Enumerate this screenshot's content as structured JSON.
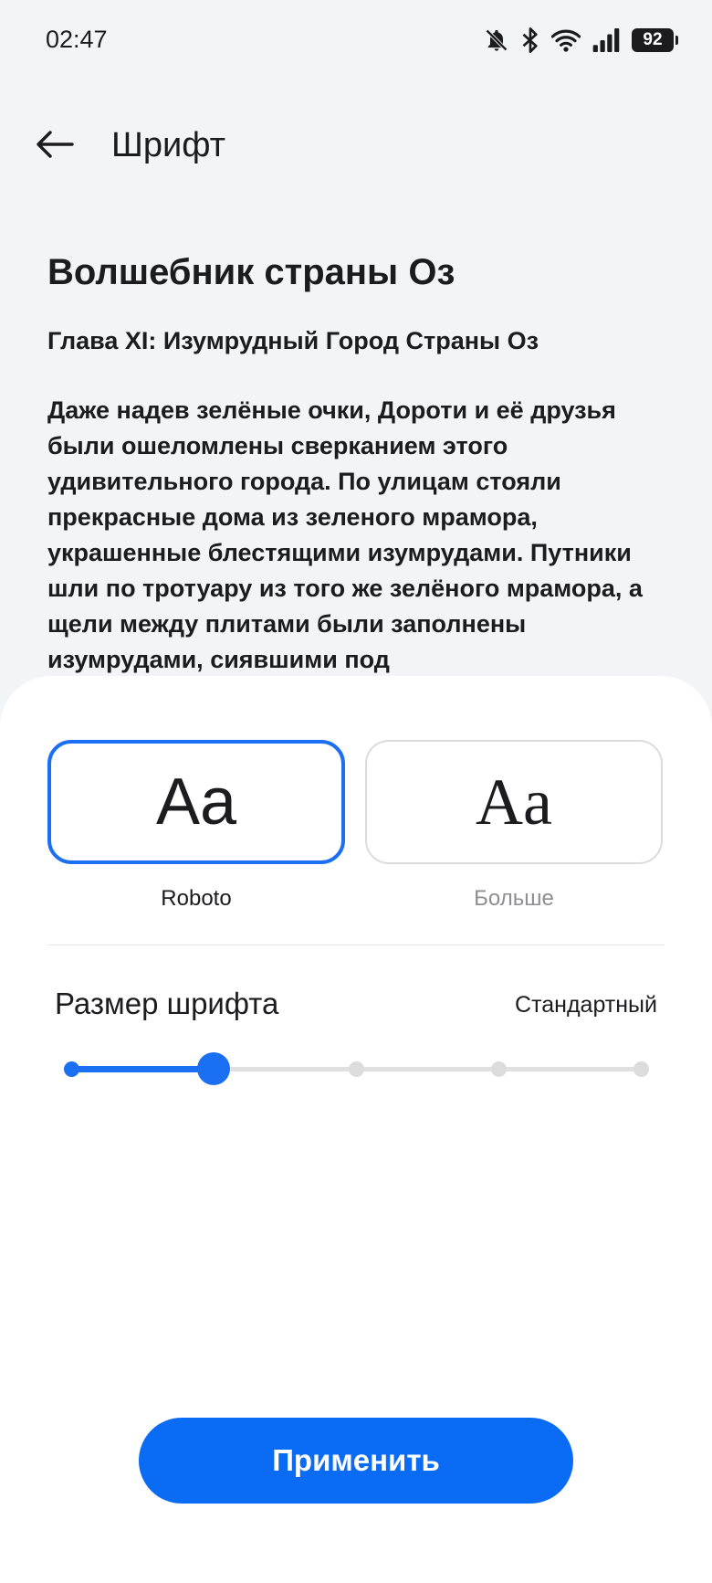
{
  "status_bar": {
    "time": "02:47",
    "battery": "92",
    "icons": [
      "bell-off-icon",
      "bluetooth-icon",
      "wifi-icon",
      "signal-icon",
      "battery-icon"
    ]
  },
  "header": {
    "title": "Шрифт",
    "back_icon": "arrow-left-icon"
  },
  "preview": {
    "title": "Волшебник страны Оз",
    "chapter": "Глава XI: Изумрудный Город Страны Оз",
    "body": "Даже надев зелёные очки, Дороти и её друзья были ошеломлены сверканием этого удивительного города. По улицам стояли прекрасные дома из зеленого мрамора, украшенные блестящими изумрудами. Путники шли по тротуару из того же зелёного мрамора, а щели между плитами были заполнены изумрудами, сиявшими под"
  },
  "font_options": [
    {
      "sample": "Aa",
      "label": "Roboto",
      "selected": true
    },
    {
      "sample": "Aa",
      "label": "Больше",
      "selected": false
    }
  ],
  "font_size": {
    "title": "Размер шрифта",
    "value": "Стандартный",
    "steps": 5,
    "current_step": 1
  },
  "apply_button": {
    "label": "Применить"
  },
  "colors": {
    "accent": "#1a6ff2",
    "button": "#0a6cf5",
    "background": "#f3f4f6",
    "sheet": "#ffffff"
  }
}
